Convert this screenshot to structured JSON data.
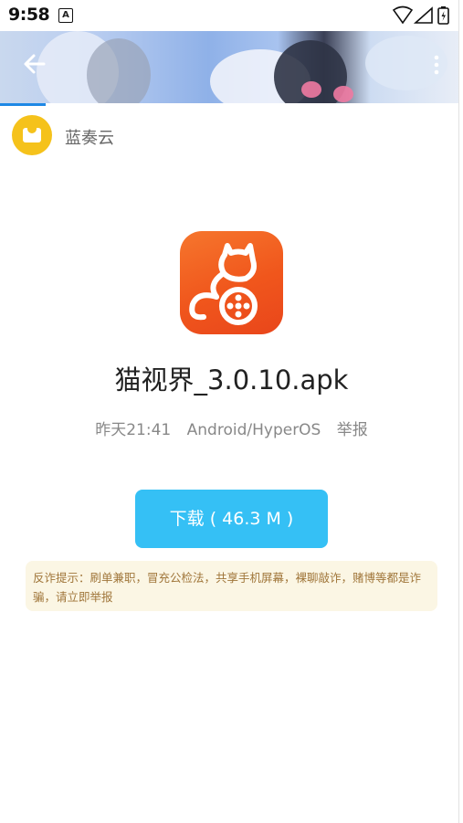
{
  "status_bar": {
    "time": "9:58",
    "notification_badge": "A",
    "icons": [
      "wifi-icon",
      "signal-icon",
      "battery-icon"
    ]
  },
  "banner": {
    "back_icon": "arrow-left-icon",
    "more_icon": "more-vertical-icon"
  },
  "site": {
    "name": "蓝奏云",
    "logo_color": "#f5c21b"
  },
  "file": {
    "name": "猫视界_3.0.10.apk",
    "time": "昨天21:41",
    "platform": "Android/HyperOS",
    "report_label": "举报"
  },
  "download": {
    "label": "下载 ( 46.3 M )",
    "color": "#35c0f5"
  },
  "notice": {
    "text": "反诈提示：刷单兼职，冒充公检法，共享手机屏幕，裸聊敲诈，赌博等都是诈骗，请立即举报"
  },
  "colors": {
    "accent": "#1e88e5",
    "app_icon": "#f0561c",
    "notice_bg": "#fbf6e4"
  }
}
